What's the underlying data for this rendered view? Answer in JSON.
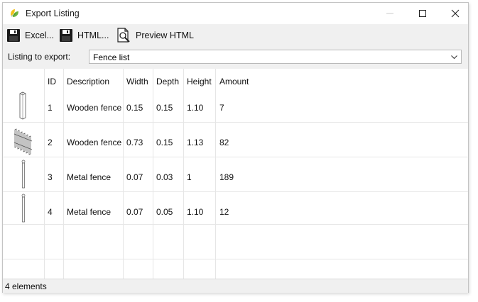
{
  "window": {
    "title": "Export Listing"
  },
  "toolbar": {
    "excel_label": "Excel...",
    "html_label": "HTML...",
    "preview_label": "Preview HTML"
  },
  "listing": {
    "label": "Listing to export:",
    "selected": "Fence list"
  },
  "table": {
    "headers": {
      "id": "ID",
      "description": "Description",
      "width": "Width",
      "depth": "Depth",
      "height": "Height",
      "amount": "Amount"
    },
    "rows": [
      {
        "thumb": "post-icon",
        "id": "1",
        "description": "Wooden fence",
        "width": "0.15",
        "depth": "0.15",
        "height": "1.10",
        "amount": "7"
      },
      {
        "thumb": "fence-panel-icon",
        "id": "2",
        "description": "Wooden fence",
        "width": "0.73",
        "depth": "0.15",
        "height": "1.13",
        "amount": "82"
      },
      {
        "thumb": "pole-icon",
        "id": "3",
        "description": "Metal fence",
        "width": "0.07",
        "depth": "0.03",
        "height": "1",
        "amount": "189"
      },
      {
        "thumb": "pole-icon",
        "id": "4",
        "description": "Metal fence",
        "width": "0.07",
        "depth": "0.05",
        "height": "1.10",
        "amount": "12"
      }
    ]
  },
  "status": {
    "text": "4 elements"
  },
  "colors": {
    "accent_green": "#6cb33f",
    "accent_yellow": "#f2c11c"
  }
}
